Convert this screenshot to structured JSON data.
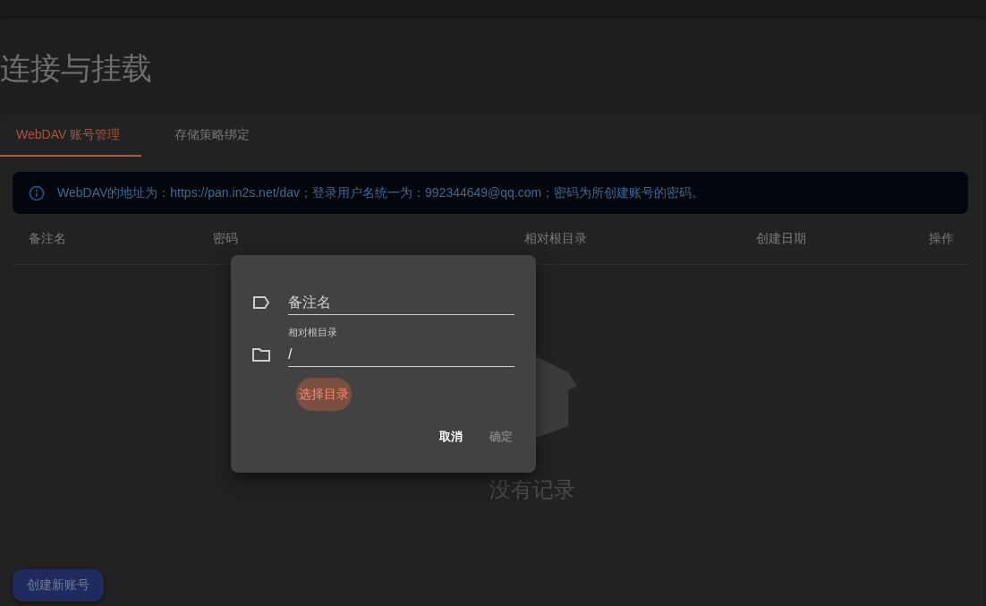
{
  "page_title": "连接与挂载",
  "tabs": [
    {
      "label": "WebDAV 账号管理",
      "selected": true
    },
    {
      "label": "存储策略绑定",
      "selected": false
    }
  ],
  "alert": {
    "text": "WebDAV的地址为：https://pan.in2s.net/dav；登录用户名统一为：992344649@qq.com；密码为所创建账号的密码。"
  },
  "table": {
    "columns": [
      "备注名",
      "密码",
      "相对根目录",
      "创建日期",
      "操作"
    ],
    "empty_text": "没有记录"
  },
  "dialog": {
    "fields": [
      {
        "kind": "name",
        "placeholder": "备注名"
      },
      {
        "kind": "folder",
        "label": "相对根目录",
        "value": "/"
      }
    ],
    "choose_button": "选择目录",
    "actions": [
      {
        "label": "取消",
        "disabled": false
      },
      {
        "label": "确定",
        "disabled": true
      }
    ]
  },
  "create_button": "创建新账号"
}
